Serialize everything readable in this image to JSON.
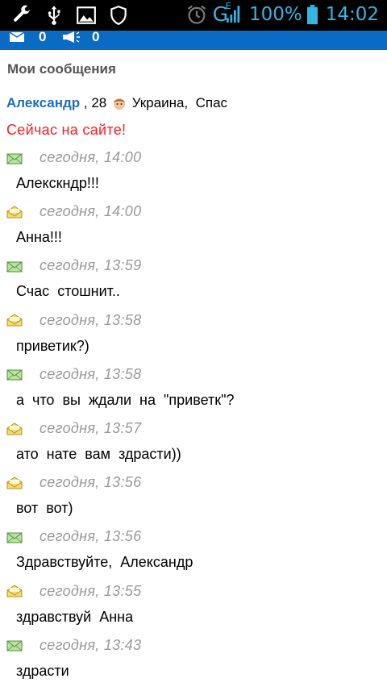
{
  "status_bar": {
    "network": "G",
    "network_sup": "E",
    "battery": "100%",
    "time": "14:02",
    "icons": [
      "wrench-icon",
      "usb-icon",
      "image-icon",
      "shield-icon",
      "alarm-icon",
      "signal-icon",
      "battery-icon"
    ]
  },
  "top_bar": {
    "mail_count": "0",
    "notify_count": "0"
  },
  "page": {
    "title": "Мои сообщения"
  },
  "user": {
    "name": "Александр",
    "info_a": " , 28 ",
    "info_b": " Украина,  Спас",
    "online": "Сейчас  на  сайте!"
  },
  "messages": [
    {
      "direction": "incoming",
      "time": "сегодня, 14:00",
      "text": "Алекскндр!!!"
    },
    {
      "direction": "outgoing",
      "time": "сегодня, 14:00",
      "text": "Анна!!!"
    },
    {
      "direction": "incoming",
      "time": "сегодня, 13:59",
      "text": "Счас  стошнит.."
    },
    {
      "direction": "outgoing",
      "time": "сегодня, 13:58",
      "text": "приветик?)"
    },
    {
      "direction": "incoming",
      "time": "сегодня, 13:58",
      "text": "а  что  вы  ждали  на  \"приветк\"?"
    },
    {
      "direction": "outgoing",
      "time": "сегодня, 13:57",
      "text": "ато  нате  вам  здрасти))"
    },
    {
      "direction": "outgoing",
      "time": "сегодня, 13:56",
      "text": "вот  вот)"
    },
    {
      "direction": "incoming",
      "time": "сегодня, 13:56",
      "text": "Здравствуйте,  Александр"
    },
    {
      "direction": "outgoing",
      "time": "сегодня, 13:55",
      "text": "здравствуй  Анна"
    },
    {
      "direction": "incoming",
      "time": "сегодня, 13:43",
      "text": "здрасти"
    }
  ],
  "colors": {
    "accent": "#0a6bc5",
    "status_accent": "#33b5e5",
    "online": "#ff1a1a",
    "username": "#1e6fbf"
  }
}
